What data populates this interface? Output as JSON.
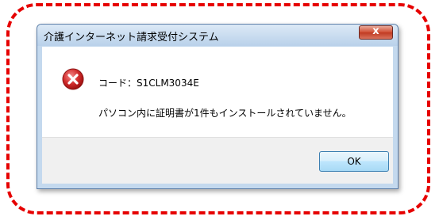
{
  "dialog": {
    "title": "介護インターネット請求受付システム",
    "close_symbol": "x",
    "icon": "error-icon",
    "code_line": "コード：S1CLM3034E",
    "message": "パソコン内に証明書が1件もインストールされていません。",
    "ok_label": "OK"
  },
  "colors": {
    "highlight_border": "#e60000",
    "error_icon": "#d02a2a",
    "ok_border": "#3c7fb1"
  }
}
